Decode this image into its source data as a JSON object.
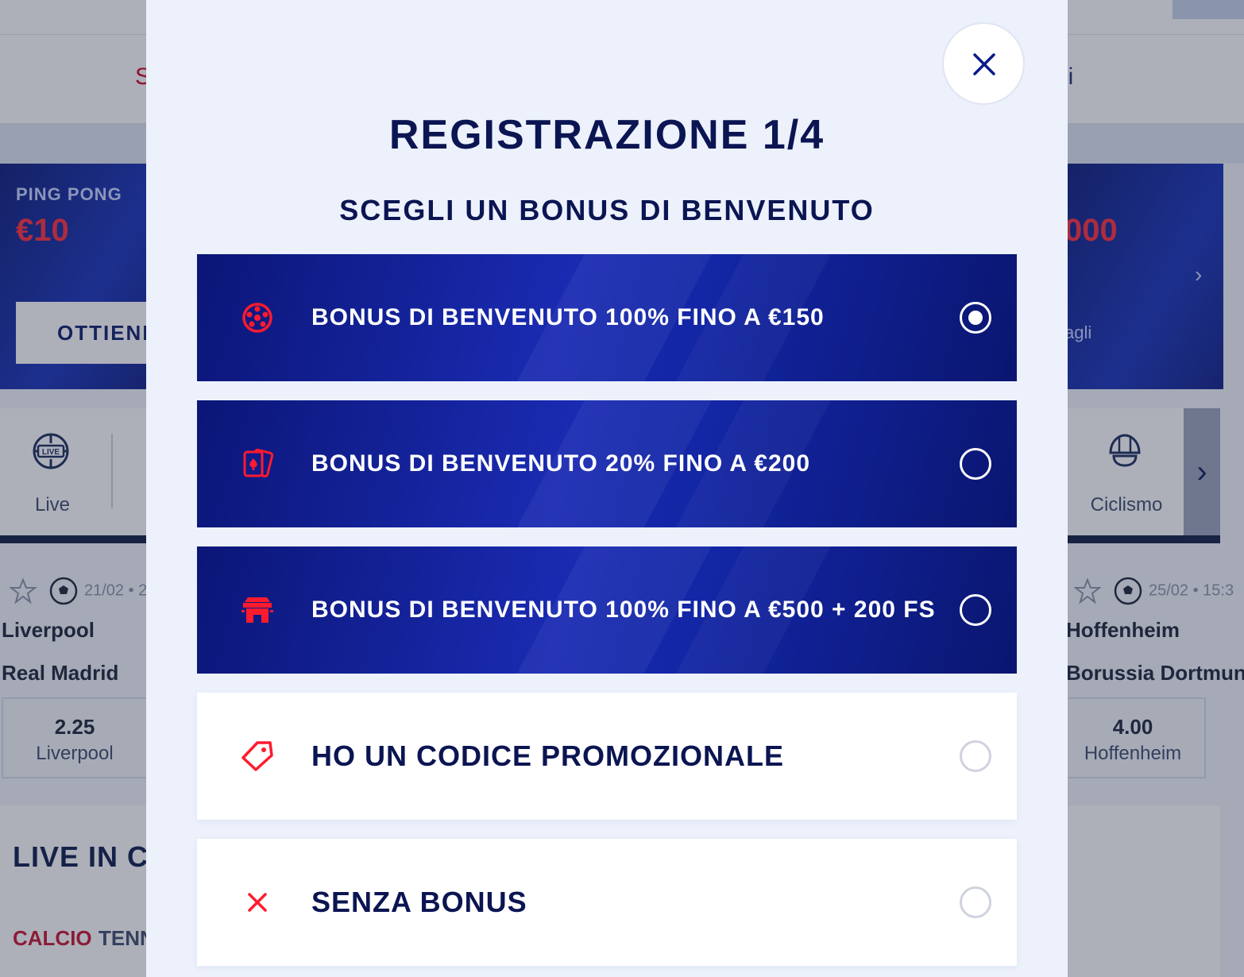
{
  "background": {
    "nav": {
      "left_partial": "S",
      "right_partial": "li"
    },
    "banner_left": {
      "kicker": "PING PONG",
      "amount": "€10",
      "cta": "OTTIENI"
    },
    "banner_right": {
      "amount": "000",
      "link": "agli"
    },
    "sports": [
      {
        "label": "Live",
        "icon": "live-globe-icon"
      },
      {
        "label": "Ciclismo",
        "icon": "cycling-helmet-icon"
      }
    ],
    "match_left": {
      "date": "21/02 • 2",
      "team_home": "Liverpool",
      "team_away": "Real Madrid",
      "odd_value": "2.25",
      "odd_label": "Liverpool"
    },
    "match_right": {
      "date": "25/02 • 15:3",
      "team_home": "Hoffenheim",
      "team_away": "Borussia Dortmund",
      "odd_value": "4.00",
      "odd_label": "Hoffenheim"
    },
    "live_section": {
      "title": "LIVE IN CO",
      "tabs": [
        "CALCIO",
        "TENN"
      ]
    }
  },
  "modal": {
    "title": "REGISTRAZIONE 1/4",
    "subtitle": "SCEGLI UN BONUS DI BENVENUTO",
    "close_icon": "close-icon",
    "options": [
      {
        "label": "BONUS DI BENVENUTO 100% FINO A €150",
        "icon": "football-icon",
        "selected": true,
        "style": "dark"
      },
      {
        "label": "BONUS DI BENVENUTO 20% FINO A €200",
        "icon": "playing-cards-icon",
        "selected": false,
        "style": "dark"
      },
      {
        "label": "BONUS DI BENVENUTO 100% FINO A €500 + 200 FS",
        "icon": "casino-temple-icon",
        "selected": false,
        "style": "dark"
      },
      {
        "label": "HO UN CODICE PROMOZIONALE",
        "icon": "price-tag-icon",
        "selected": false,
        "style": "light"
      },
      {
        "label": "SENZA BONUS",
        "icon": "cross-icon",
        "selected": false,
        "style": "light"
      }
    ]
  },
  "colors": {
    "brand_navy": "#0b1552",
    "accent_red": "#ff1a2e",
    "option_blue": "#1a2bb2",
    "modal_bg": "#ecf1fc"
  }
}
